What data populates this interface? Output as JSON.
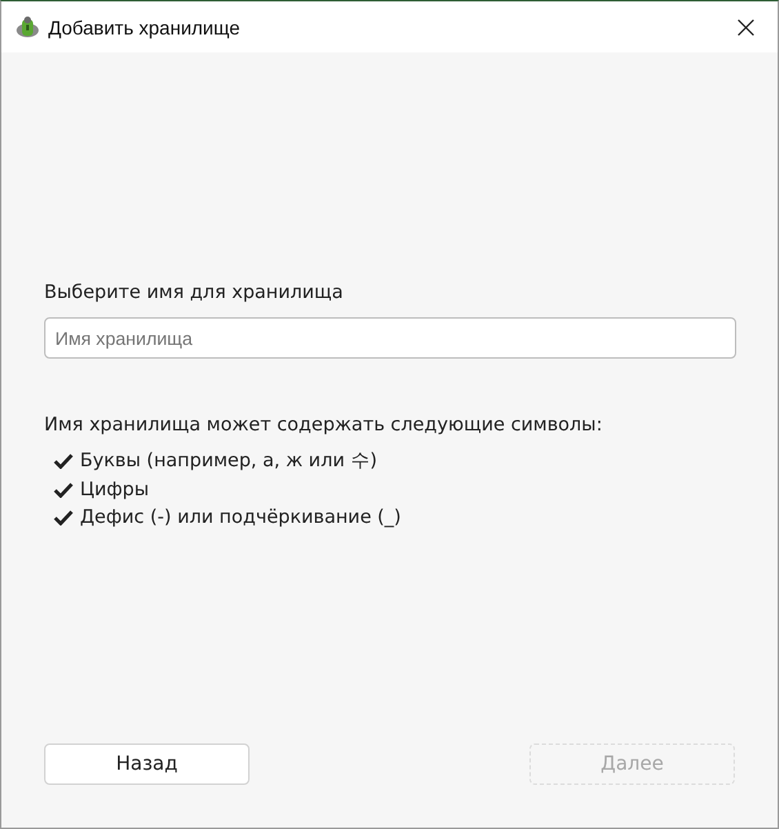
{
  "window": {
    "title": "Добавить хранилище"
  },
  "name_label": "Выберите имя для хранилища",
  "name_field": {
    "placeholder": "Имя хранилища"
  },
  "rules": {
    "heading": "Имя хранилища может содержать следующие символы:",
    "items": [
      "Буквы (например, а, ж или 수)",
      "Цифры",
      "Дефис (-) или подчёркивание (_)"
    ]
  },
  "buttons": [
    {
      "label": "Назад",
      "disabled": false
    },
    {
      "label": "Далее",
      "disabled": true
    }
  ]
}
